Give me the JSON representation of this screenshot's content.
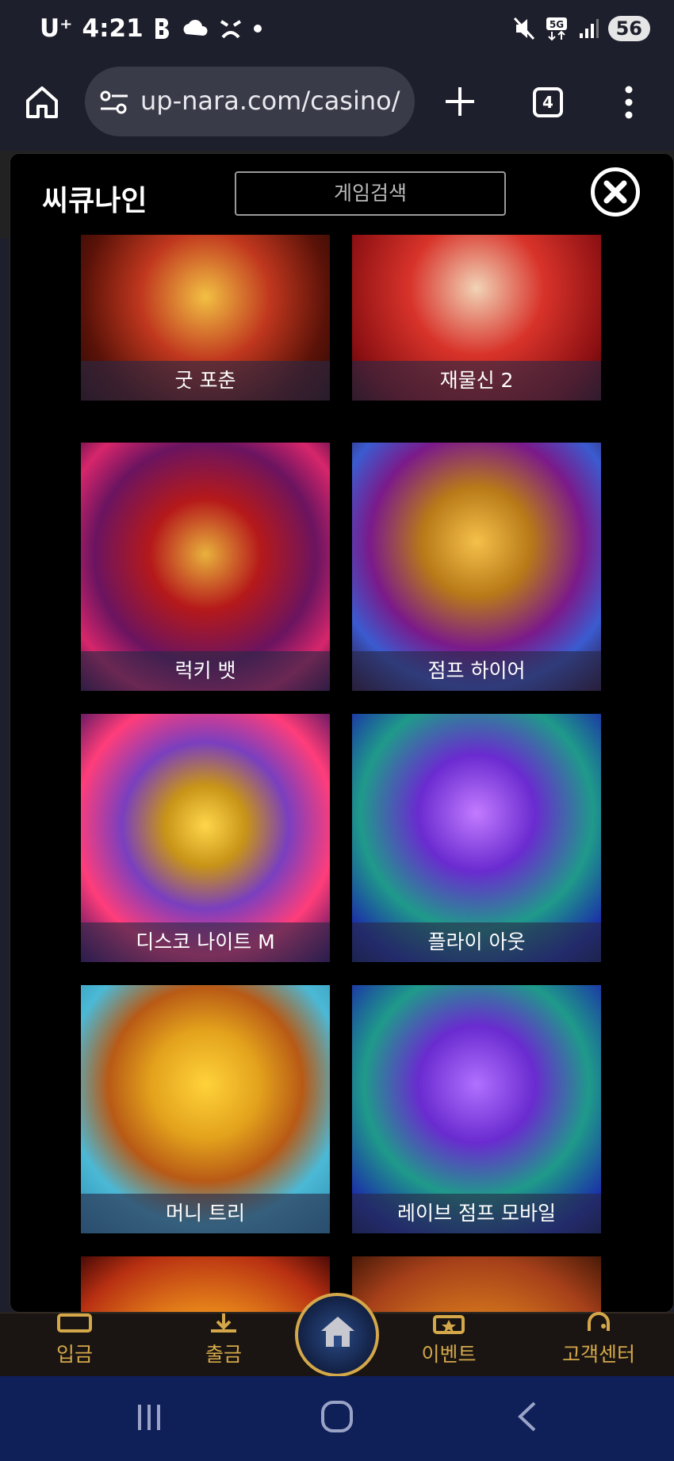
{
  "status_bar": {
    "carrier": "U⁺",
    "time": "4:21",
    "battery": "56",
    "network": "5G"
  },
  "browser": {
    "url": "up-nara.com/casino/",
    "tab_count": "4"
  },
  "modal": {
    "title": "씨큐나인",
    "search_placeholder": "게임검색"
  },
  "games": [
    {
      "label": "굿 포춘"
    },
    {
      "label": "재물신 2"
    },
    {
      "label": "럭키 뱃"
    },
    {
      "label": "점프 하이어"
    },
    {
      "label": "디스코 나이트 M"
    },
    {
      "label": "플라이 아웃"
    },
    {
      "label": "머니 트리"
    },
    {
      "label": "레이브 점프 모바일"
    },
    {
      "label": ""
    },
    {
      "label": ""
    }
  ],
  "bottom_nav": {
    "deposit": "입금",
    "withdraw": "출금",
    "event": "이벤트",
    "support": "고객센터"
  },
  "colors": {
    "gold": "#d4a84a",
    "browser_bg": "#1e1f2c",
    "system_nav": "#0f1f58"
  }
}
